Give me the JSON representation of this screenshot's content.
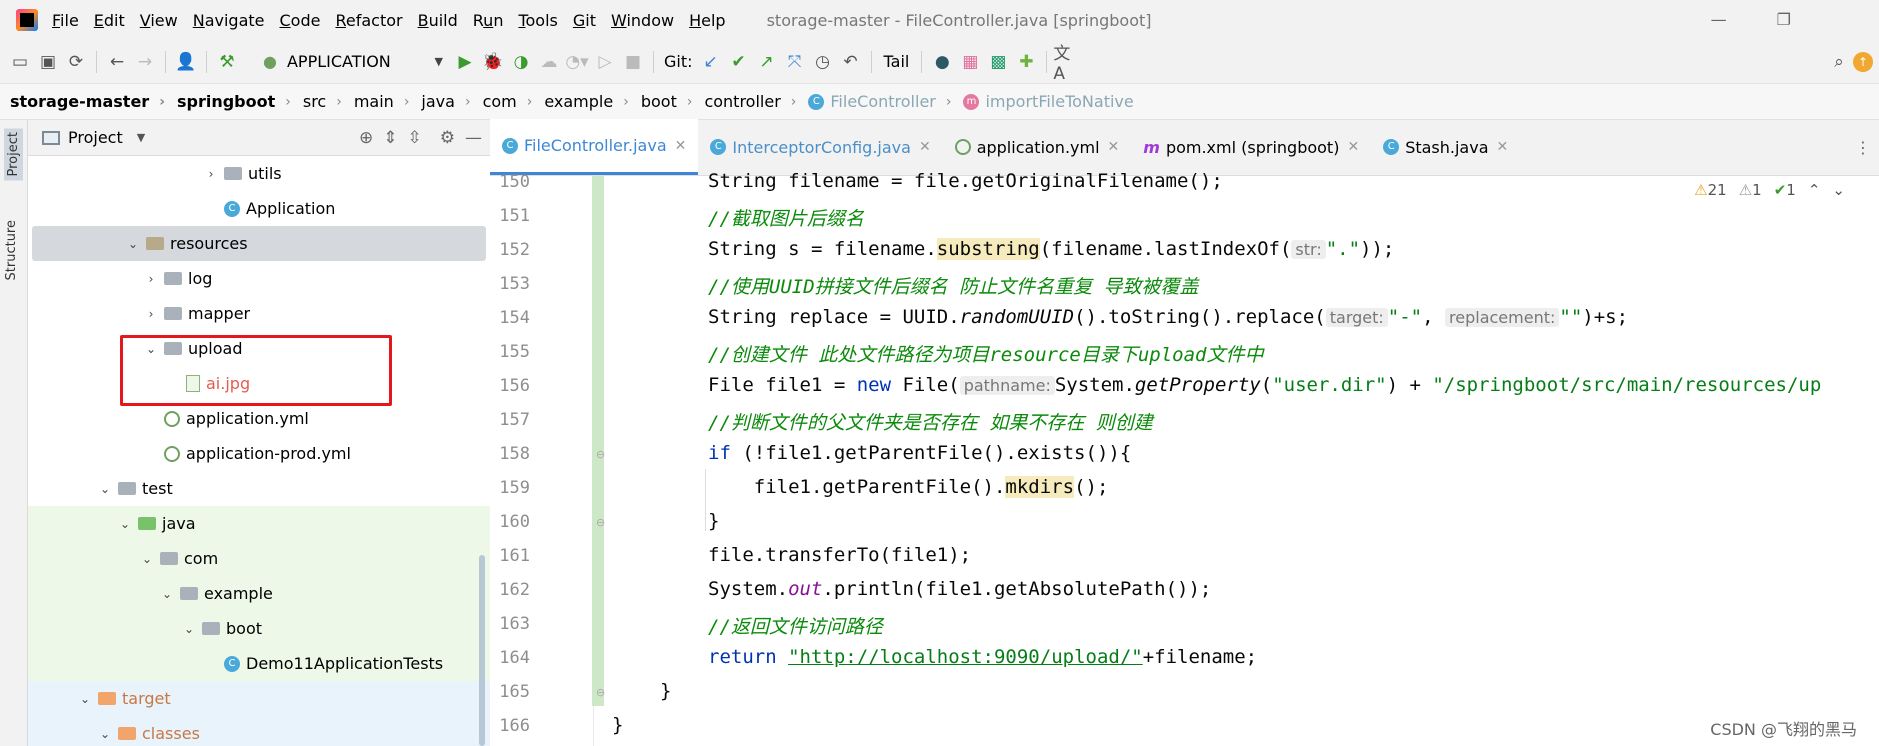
{
  "menubar": {
    "items": [
      "File",
      "Edit",
      "View",
      "Navigate",
      "Code",
      "Refactor",
      "Build",
      "Run",
      "Tools",
      "Git",
      "Window",
      "Help"
    ],
    "mnemonics": [
      "F",
      "E",
      "V",
      "N",
      "C",
      "R",
      "B",
      "u",
      "T",
      "G",
      "W",
      "H"
    ],
    "window_title": "storage-master - FileController.java [springboot]"
  },
  "toolbar": {
    "run_config": "APPLICATION",
    "git_label": "Git:",
    "tail_label": "Tail"
  },
  "breadcrumbs": [
    "storage-master",
    "springboot",
    "src",
    "main",
    "java",
    "com",
    "example",
    "boot",
    "controller",
    "FileController",
    "importFileToNative"
  ],
  "side_strip": {
    "project": "Project",
    "structure": "Structure"
  },
  "project_panel": {
    "title": "Project",
    "tree": [
      {
        "label": "utils",
        "kind": "folder",
        "expanded": false
      },
      {
        "label": "Application",
        "kind": "class"
      },
      {
        "label": "resources",
        "kind": "res-folder",
        "expanded": true,
        "selected": true
      },
      {
        "label": "log",
        "kind": "folder",
        "expanded": false
      },
      {
        "label": "mapper",
        "kind": "folder",
        "expanded": false
      },
      {
        "label": "upload",
        "kind": "folder",
        "expanded": true
      },
      {
        "label": "ai.jpg",
        "kind": "file"
      },
      {
        "label": "application.yml",
        "kind": "yml"
      },
      {
        "label": "application-prod.yml",
        "kind": "yml"
      },
      {
        "label": "test",
        "kind": "folder",
        "expanded": true
      },
      {
        "label": "java",
        "kind": "green-folder",
        "expanded": true
      },
      {
        "label": "com",
        "kind": "folder",
        "expanded": true
      },
      {
        "label": "example",
        "kind": "folder",
        "expanded": true
      },
      {
        "label": "boot",
        "kind": "folder",
        "expanded": true
      },
      {
        "label": "Demo11ApplicationTests",
        "kind": "class"
      },
      {
        "label": "target",
        "kind": "orange-folder",
        "expanded": true
      },
      {
        "label": "classes",
        "kind": "orange-folder",
        "expanded": true
      }
    ]
  },
  "editor": {
    "tabs": [
      {
        "label": "FileController.java",
        "icon": "class-icon",
        "active": true
      },
      {
        "label": "InterceptorConfig.java",
        "icon": "class-icon",
        "active": false
      },
      {
        "label": "application.yml",
        "icon": "yml-icon",
        "active": false
      },
      {
        "label": "pom.xml (springboot)",
        "icon": "maven-icon",
        "active": false
      },
      {
        "label": "Stash.java",
        "icon": "class-icon",
        "active": false
      }
    ],
    "inspections": {
      "warnings": "21",
      "weak_warnings": "1",
      "ok": "1"
    },
    "line_numbers": [
      "150",
      "151",
      "152",
      "153",
      "154",
      "155",
      "156",
      "157",
      "158",
      "159",
      "160",
      "161",
      "162",
      "163",
      "164",
      "165",
      "166"
    ],
    "code": {
      "l150": "String filename = file.getOriginalFilename();",
      "l151": "//截取图片后缀名",
      "l152a": "String s = filename.",
      "l152b": "substring",
      "l152c": "(filename.lastIndexOf(",
      "l152hint": "str:",
      "l152d": "\".\"",
      "l152e": "));",
      "l153": "//使用UUID拼接文件后缀名 防止文件名重复 导致被覆盖",
      "l154a": "String replace = UUID.",
      "l154b": "randomUUID",
      "l154c": "().toString().replace(",
      "l154hint1": "target:",
      "l154d": "\"-\"",
      "l154e": ",",
      "l154hint2": "replacement:",
      "l154f": "\"\"",
      "l154g": ")+s;",
      "l155": "//创建文件 此处文件路径为项目resource目录下upload文件中",
      "l156a": "File file1 = ",
      "l156kw": "new",
      "l156b": " File(",
      "l156hint": "pathname:",
      "l156c": "System.",
      "l156d": "getProperty",
      "l156e": "(",
      "l156f": "\"user.dir\"",
      "l156g": ") + ",
      "l156h": "\"/springboot/src/main/resources/up",
      "l157": "//判断文件的父文件夹是否存在 如果不存在 则创建",
      "l158kw": "if",
      "l158": " (!file1.getParentFile().exists()){",
      "l159a": "    file1.getParentFile().",
      "l159b": "mkdirs",
      "l159c": "();",
      "l160": "}",
      "l161": "file.transferTo(file1);",
      "l162a": "System.",
      "l162b": "out",
      "l162c": ".println(file1.getAbsolutePath());",
      "l163": "//返回文件访问路径",
      "l164kw": "return",
      "l164a": " ",
      "l164str": "\"http://localhost:9090/upload/\"",
      "l164b": "+filename;",
      "l165": "}",
      "l166": "}"
    }
  },
  "watermark": "CSDN @飞翔的黑马",
  "colors": {
    "accent": "#3d87d6",
    "highlight_box": "#e4171b",
    "comment": "#0b8a0b",
    "keyword": "#0033b3",
    "string": "#067d17"
  }
}
